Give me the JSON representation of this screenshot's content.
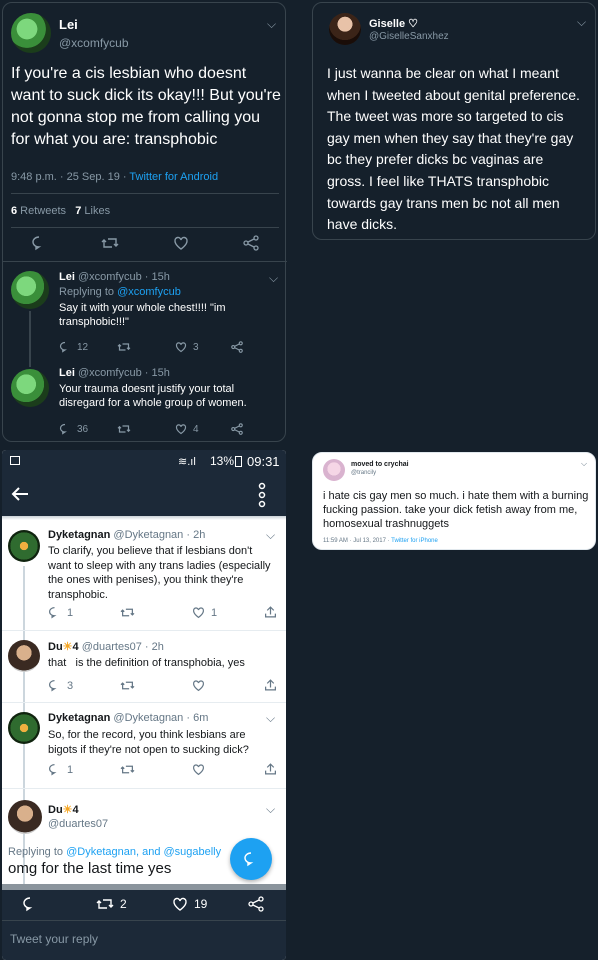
{
  "tl": {
    "name": "Lei",
    "handle": "@xcomfycub",
    "text": "If you're a cis lesbian who doesnt want to suck dick its okay!!! But you're not gonna stop me from calling you for what you are: transphobic",
    "time": "9:48 p.m. · 25 Sep. 19 · ",
    "source": "Twitter for Android",
    "retweets_count": "6",
    "retweets_label": " Retweets",
    "likes_count": "7",
    "likes_label": " Likes",
    "reply1": {
      "name": "Lei",
      "handle": "@xcomfycub · 15h",
      "replying_prefix": "Replying to ",
      "replying_handle": "@xcomfycub",
      "text": "Say it with your whole chest!!!! \"im transphobic!!!\"",
      "replies": "12",
      "likes": "3"
    },
    "reply2": {
      "name": "Lei",
      "handle": "@xcomfycub · 15h",
      "text": "Your trauma doesnt justify your total disregard for a whole group of women.",
      "replies": "36",
      "likes": "4"
    }
  },
  "tr": {
    "name": "Giselle",
    "name_icon": "♡",
    "handle": "@GiselleSanxhez",
    "text": "I just wanna be clear on what I meant when I tweeted about genital preference. The tweet was more so targeted to cis gay men when they say that they're gay bc they prefer dicks bc vaginas are gross. I feel like THATS transphobic towards gay trans men bc not all men have dicks."
  },
  "phone": {
    "status_signal": "≋.ıl",
    "status_battery": "13%",
    "status_time": "09:31",
    "t1": {
      "name": "Dyketagnan",
      "handle": "@Dyketagnan · 2h",
      "text": "To clarify, you believe that if lesbians don't want to sleep with any trans ladies (especially the ones with penises), you think they're transphobic.",
      "replies": "1",
      "likes": "1"
    },
    "t2": {
      "name": "Du",
      "emoji": "☀",
      "name_suffix": "4",
      "handle": "@duartes07 · 2h",
      "text": "that   is the definition of transphobia, yes",
      "replies": "3"
    },
    "t3": {
      "name": "Dyketagnan",
      "handle": "@Dyketagnan · 6m",
      "text": "So, for the record, you think lesbians are bigots if they're not open to sucking dick?",
      "replies": "1"
    },
    "t4": {
      "name": "Du",
      "emoji": "☀",
      "name_suffix": "4",
      "handle": "@duartes07",
      "replying_prefix": "Replying to ",
      "replying_handles": "@Dyketagnan, and @sugabelly",
      "text": "omg for the last time yes",
      "retweets": "2",
      "likes": "19"
    },
    "reply_placeholder": "Tweet your reply"
  },
  "mr": {
    "name": "moved to crychai",
    "handle": "@trancily",
    "text": "i hate cis gay men so much. i hate them with a burning fucking passion. take your dick fetish away from me, homosexual trashnuggets",
    "time": "11:59 AM · Jul 13, 2017 · ",
    "source": "Twitter for iPhone"
  },
  "colors": {
    "twitter_blue": "#1da1f2",
    "dark_bg": "#15202b",
    "dark_border": "#38444d",
    "muted": "#8899a6",
    "phone_bar": "#1c2938"
  }
}
